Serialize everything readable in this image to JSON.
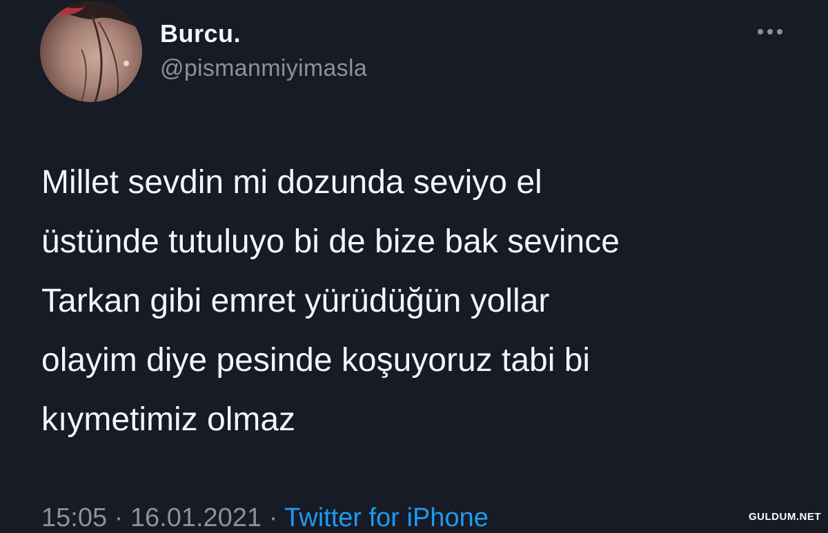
{
  "tweet": {
    "author": {
      "display_name": "Burcu.",
      "handle": "@pismanmiyimasla",
      "avatar_icon": "user-avatar"
    },
    "more_icon": "more-horizontal-icon",
    "text_lines": [
      "Millet sevdin mi dozunda seviyo el",
      "üstünde tutuluyo bi de bize bak sevince",
      "Tarkan gibi emret yürüdüğün yollar",
      "olayim diye pesinde koşuyoruz tabi bi",
      "kıymetimiz olmaz"
    ],
    "time": "15:05",
    "separator_1": " · ",
    "date": "16.01.2021",
    "separator_2": " · ",
    "source": "Twitter for iPhone"
  },
  "watermark": "GULDUM.NET",
  "colors": {
    "background": "#161b26",
    "text": "#f3f5f8",
    "secondary": "#8a929c",
    "link": "#1d9bf0"
  }
}
